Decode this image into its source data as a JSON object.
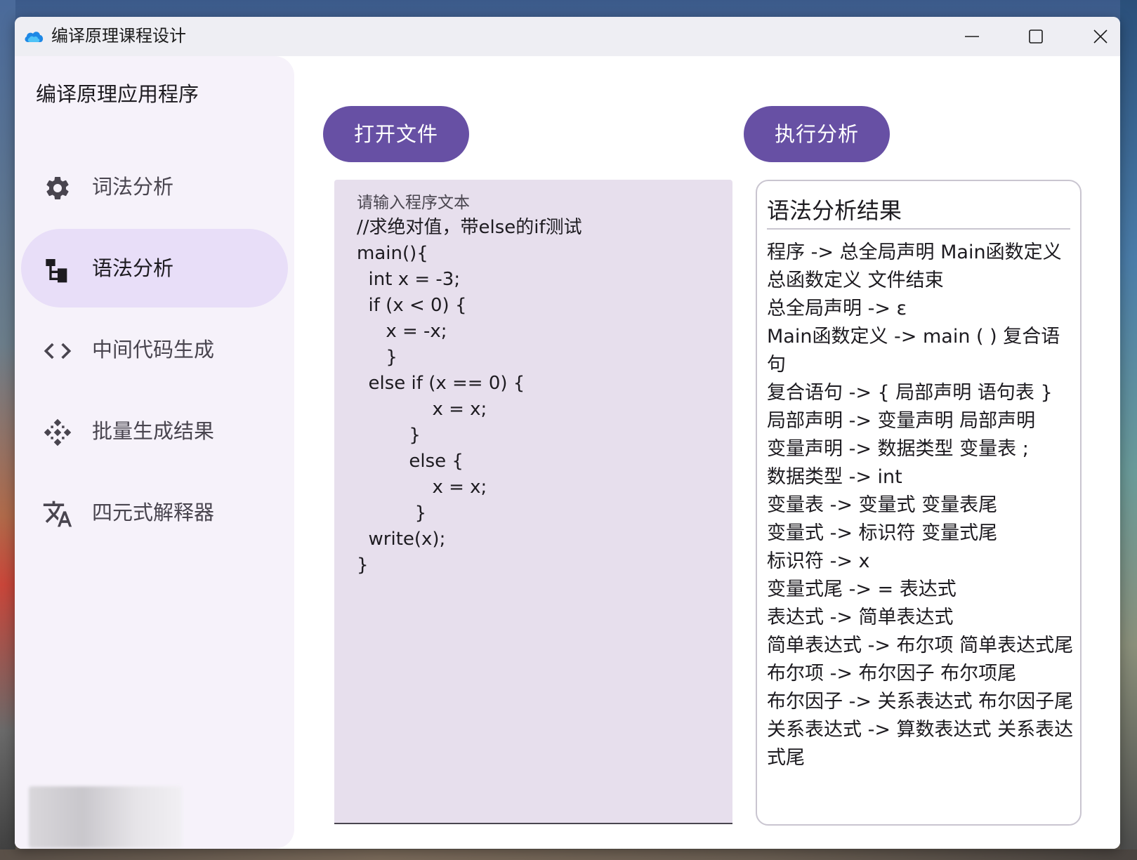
{
  "window": {
    "title": "编译原理课程设计"
  },
  "sidebar": {
    "title": "编译原理应用程序",
    "items": [
      {
        "label": "词法分析",
        "icon": "gear-icon",
        "active": false
      },
      {
        "label": "语法分析",
        "icon": "tree-icon",
        "active": true
      },
      {
        "label": "中间代码生成",
        "icon": "code-icon",
        "active": false
      },
      {
        "label": "批量生成结果",
        "icon": "batch-icon",
        "active": false
      },
      {
        "label": "四元式解释器",
        "icon": "translate-icon",
        "active": false
      }
    ]
  },
  "toolbar": {
    "open_label": "打开文件",
    "run_label": "执行分析"
  },
  "editor": {
    "label": "请输入程序文本",
    "code": "//求绝对值，带else的if测试\nmain(){\n  int x = -3;\n  if (x < 0) {\n     x = -x;\n     }\n  else if (x == 0) {\n             x = x;\n         }\n         else {\n             x = x;\n          }\n  write(x);\n}"
  },
  "result": {
    "title": "语法分析结果",
    "lines": [
      "程序 -> 总全局声明 Main函数定义 总函数定义 文件结束",
      "总全局声明 -> ε",
      "Main函数定义 -> main ( ) 复合语句",
      "复合语句 -> { 局部声明 语句表 }",
      "局部声明 -> 变量声明 局部声明",
      "变量声明 -> 数据类型 变量表 ;",
      "数据类型 -> int",
      "变量表 -> 变量式 变量表尾",
      "变量式 -> 标识符 变量式尾",
      "标识符 -> x",
      "变量式尾 -> = 表达式",
      "表达式 -> 简单表达式",
      "简单表达式 -> 布尔项 简单表达式尾",
      "布尔项 -> 布尔因子 布尔项尾",
      "布尔因子 -> 关系表达式 布尔因子尾",
      "关系表达式 -> 算数表达式 关系表达式尾"
    ]
  },
  "colors": {
    "accent": "#6750a4",
    "active_nav": "#e8def8",
    "editor_bg": "#e7dfed"
  }
}
